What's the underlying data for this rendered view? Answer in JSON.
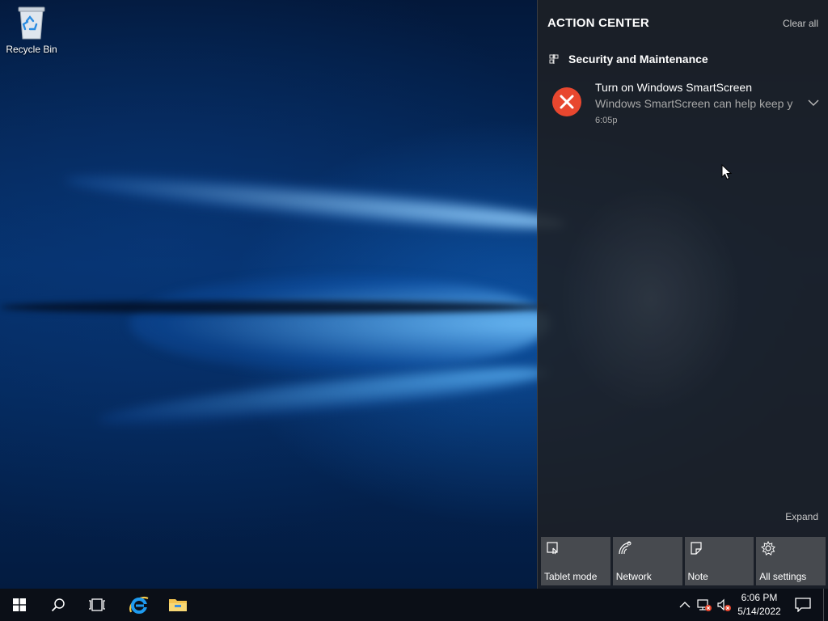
{
  "desktop": {
    "icons": [
      {
        "label": "Recycle Bin",
        "icon": "recycle-bin-icon"
      }
    ]
  },
  "action_center": {
    "title": "ACTION CENTER",
    "clear_all": "Clear all",
    "group": {
      "name": "Security and Maintenance",
      "icon": "security-flag-icon"
    },
    "notification": {
      "title": "Turn on Windows SmartScreen",
      "body": "Windows SmartScreen can help keep y",
      "time": "6:05p",
      "icon": "error-icon"
    },
    "expand": "Expand",
    "quick_actions": [
      {
        "label": "Tablet mode",
        "icon": "tablet-mode-icon"
      },
      {
        "label": "Network",
        "icon": "network-icon"
      },
      {
        "label": "Note",
        "icon": "note-icon"
      },
      {
        "label": "All settings",
        "icon": "gear-icon"
      }
    ]
  },
  "taskbar": {
    "pinned": [
      "start-icon",
      "search-icon",
      "task-view-icon",
      "internet-explorer-icon",
      "file-explorer-icon"
    ],
    "tray": [
      "chevron-up-icon",
      "network-error-icon",
      "volume-muted-icon"
    ],
    "clock": {
      "time": "6:06 PM",
      "date": "5/14/2022"
    }
  },
  "colors": {
    "accent_blue": "#1d8bf2",
    "error_red": "#e8472f",
    "action_center_bg": "#1e2024",
    "tile_bg": "#505256",
    "taskbar_bg": "#0b0f17"
  }
}
